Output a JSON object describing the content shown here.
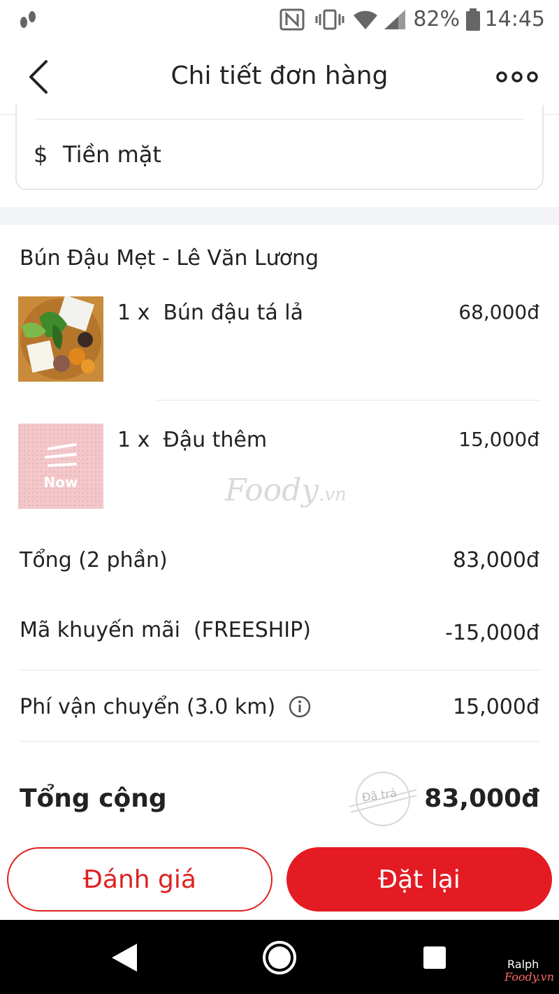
{
  "status_bar": {
    "battery_percent": "82%",
    "time": "14:45",
    "icons": [
      "footprints-icon",
      "nfc-icon",
      "vibrate-icon",
      "wifi-icon",
      "signal-icon",
      "battery-icon"
    ]
  },
  "header": {
    "title": "Chi tiết đơn hàng",
    "back_icon": "chevron-left-icon",
    "more_icon": "more-dots-icon"
  },
  "payment": {
    "icon_text": "$",
    "method": "Tiền mặt"
  },
  "order": {
    "restaurant": "Bún Đậu Mẹt - Lê Văn Lương",
    "items": [
      {
        "quantity_name": "1 x  Bún đậu tá lả",
        "price": "68,000đ",
        "thumb": "food-photo"
      },
      {
        "quantity_name": "1 x  Đậu thêm",
        "price": "15,000đ",
        "thumb": "now-placeholder",
        "thumb_label": "Now"
      }
    ]
  },
  "summary": {
    "subtotal_label": "Tổng (2 phần)",
    "subtotal_value": "83,000đ",
    "promo_label": "Mã khuyến mãi  (FREESHIP)",
    "promo_value": "-15,000đ",
    "shipping_label": "Phí vận chuyển (3.0 km)",
    "shipping_value": "15,000đ",
    "total_label": "Tổng cộng",
    "total_value": "83,000đ",
    "paid_stamp": "Đã trả"
  },
  "actions": {
    "review_label": "Đánh giá",
    "reorder_label": "Đặt lại"
  },
  "watermark": {
    "brand": "Foody",
    "suffix": ".vn",
    "corner_user": "Ralph",
    "corner_brand": "Foody.vn"
  },
  "colors": {
    "accent": "#e41b23",
    "divider": "#e6e6e6",
    "section_gap": "#f2f4f7"
  }
}
